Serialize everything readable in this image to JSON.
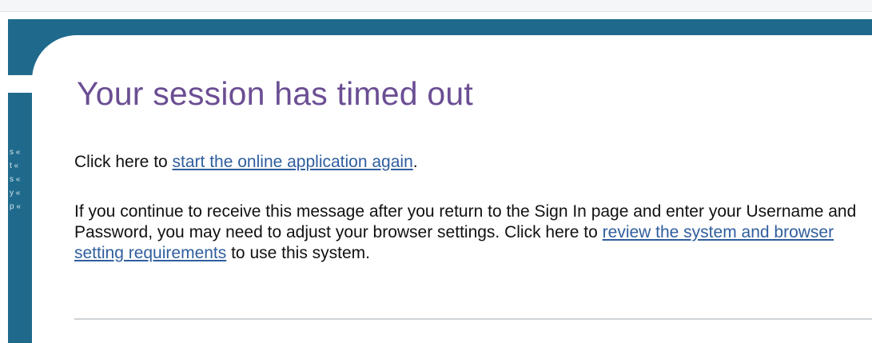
{
  "side_nav": {
    "items": [
      {
        "label": "s «"
      },
      {
        "label": "t «"
      },
      {
        "label": "s «"
      },
      {
        "label": "y «"
      },
      {
        "label": "p «"
      }
    ]
  },
  "main": {
    "title": "Your session has timed out",
    "para1": {
      "prefix": "Click here to ",
      "link": "start the online application again",
      "suffix": "."
    },
    "para2": {
      "prefix": "If you continue to receive this message after you return to the Sign In page and enter your Username and Password, you may need to adjust your browser settings. Click here to ",
      "link": "review the system and browser setting requirements",
      "suffix": " to use this system."
    }
  },
  "colors": {
    "brand_bar": "#1f6a8c",
    "title": "#6b4e93",
    "link": "#2f5e9e"
  }
}
